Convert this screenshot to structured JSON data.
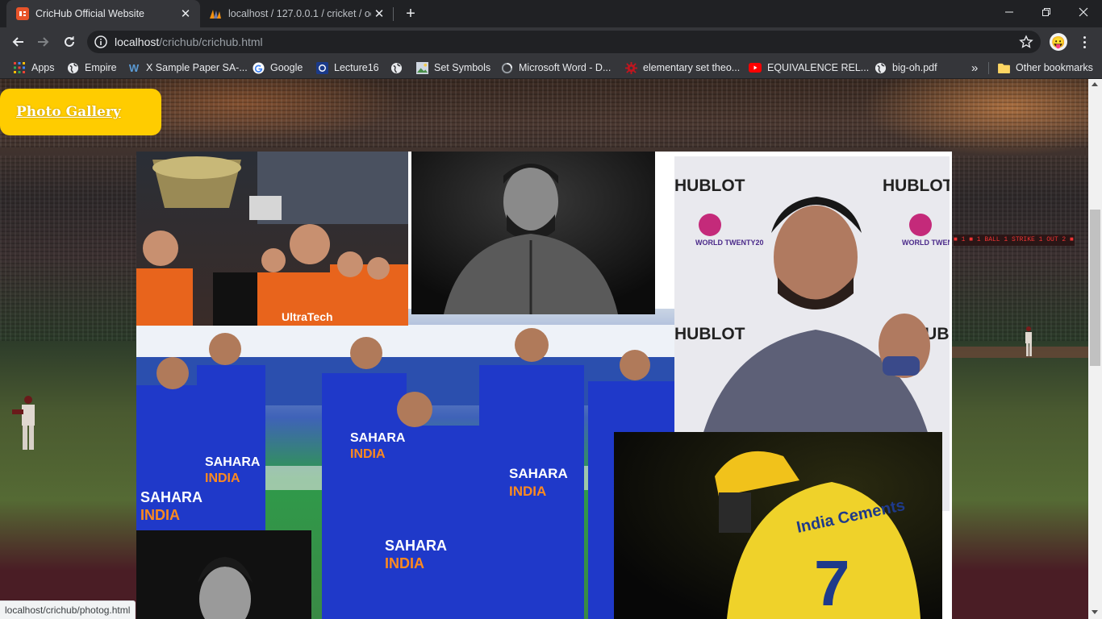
{
  "tabs": [
    {
      "title": "CricHub Official Website",
      "active": true
    },
    {
      "title": "localhost / 127.0.0.1 / cricket / oc",
      "active": false
    }
  ],
  "toolbar": {
    "url_host": "localhost",
    "url_path": "/crichub/crichub.html"
  },
  "bookmarks": [
    {
      "label": "Apps",
      "icon": "apps-grid-icon"
    },
    {
      "label": "Empire",
      "icon": "globe-icon"
    },
    {
      "label": "X Sample Paper SA-...",
      "icon": "w-logo-icon"
    },
    {
      "label": "Google",
      "icon": "google-icon"
    },
    {
      "label": "Lecture16",
      "icon": "lecture-icon"
    },
    {
      "label": "",
      "icon": "globe-icon"
    },
    {
      "label": "Set Symbols",
      "icon": "image-icon"
    },
    {
      "label": "Microsoft Word - D...",
      "icon": "loading-icon"
    },
    {
      "label": "elementary set theo...",
      "icon": "red-gear-icon"
    },
    {
      "label": "EQUIVALENCE REL...",
      "icon": "youtube-icon"
    },
    {
      "label": "big-oh.pdf",
      "icon": "globe-icon"
    }
  ],
  "bookmarks_overflow": "»",
  "other_bookmarks": "Other bookmarks",
  "page": {
    "gallery_link": "Photo Gallery",
    "scoreboard_text": "■ 1 ■ 1 BALL 1 STRIKE 1 OUT 2 ■",
    "photos": [
      {
        "name": "photo-trophy-celebration",
        "subject": "Team celebrating with trophy"
      },
      {
        "name": "photo-player-portrait-bw",
        "subject": "Player portrait black and white"
      },
      {
        "name": "photo-player-hublot-backdrop",
        "subject": "Player at T20 World Cup Hublot backdrop"
      },
      {
        "name": "photo-team-india-group",
        "subject": "Team India in blue jerseys"
      },
      {
        "name": "photo-player-yellow-jersey",
        "subject": "Player in yellow jersey number 7"
      },
      {
        "name": "photo-player-portrait-bw-2",
        "subject": "Player portrait black and white"
      }
    ],
    "hublot_text": "HUBLOT",
    "worldcup_text": "WORLD TWENTY20",
    "sahara_text": "SAHARA",
    "india_text": "INDIA",
    "jersey_sponsor": "India Cements",
    "jersey_number": "7",
    "ultratech_text": "UltraTech"
  },
  "statusbar_url": "localhost/crichub/photog.html",
  "colors": {
    "gallery_button": "#ffcc00",
    "browser_dark": "#202124",
    "browser_toolbar": "#35363a"
  }
}
